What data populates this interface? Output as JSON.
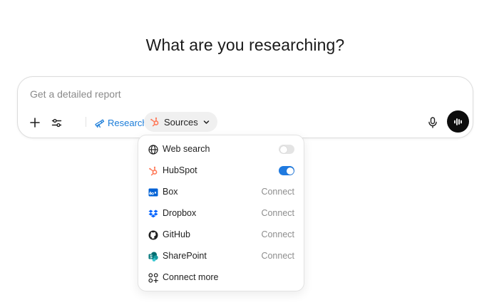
{
  "heading": "What are you researching?",
  "composer": {
    "placeholder": "Get a detailed report",
    "research_chip": {
      "label": "Research",
      "remove": "×",
      "icon": "telescope-icon"
    },
    "sources_chip": {
      "label": "Sources",
      "icon": "hubspot-icon"
    }
  },
  "colors": {
    "accent": "#1a7cd9",
    "toggle_on": "#1f7ae0",
    "hubspot": "#ff7a59",
    "box": "#0061d5",
    "dropbox": "#0061fe",
    "sharepoint": "#038387"
  },
  "sources_menu": {
    "items": [
      {
        "label": "Web search",
        "icon": "globe-icon",
        "type": "toggle",
        "enabled": false
      },
      {
        "label": "HubSpot",
        "icon": "hubspot-icon",
        "type": "toggle",
        "enabled": true
      },
      {
        "label": "Box",
        "icon": "box-icon",
        "type": "connect",
        "action": "Connect"
      },
      {
        "label": "Dropbox",
        "icon": "dropbox-icon",
        "type": "connect",
        "action": "Connect"
      },
      {
        "label": "GitHub",
        "icon": "github-icon",
        "type": "connect",
        "action": "Connect"
      },
      {
        "label": "SharePoint",
        "icon": "sharepoint-icon",
        "type": "connect",
        "action": "Connect"
      },
      {
        "label": "Connect more",
        "icon": "apps-plus-icon",
        "type": "link"
      }
    ]
  }
}
